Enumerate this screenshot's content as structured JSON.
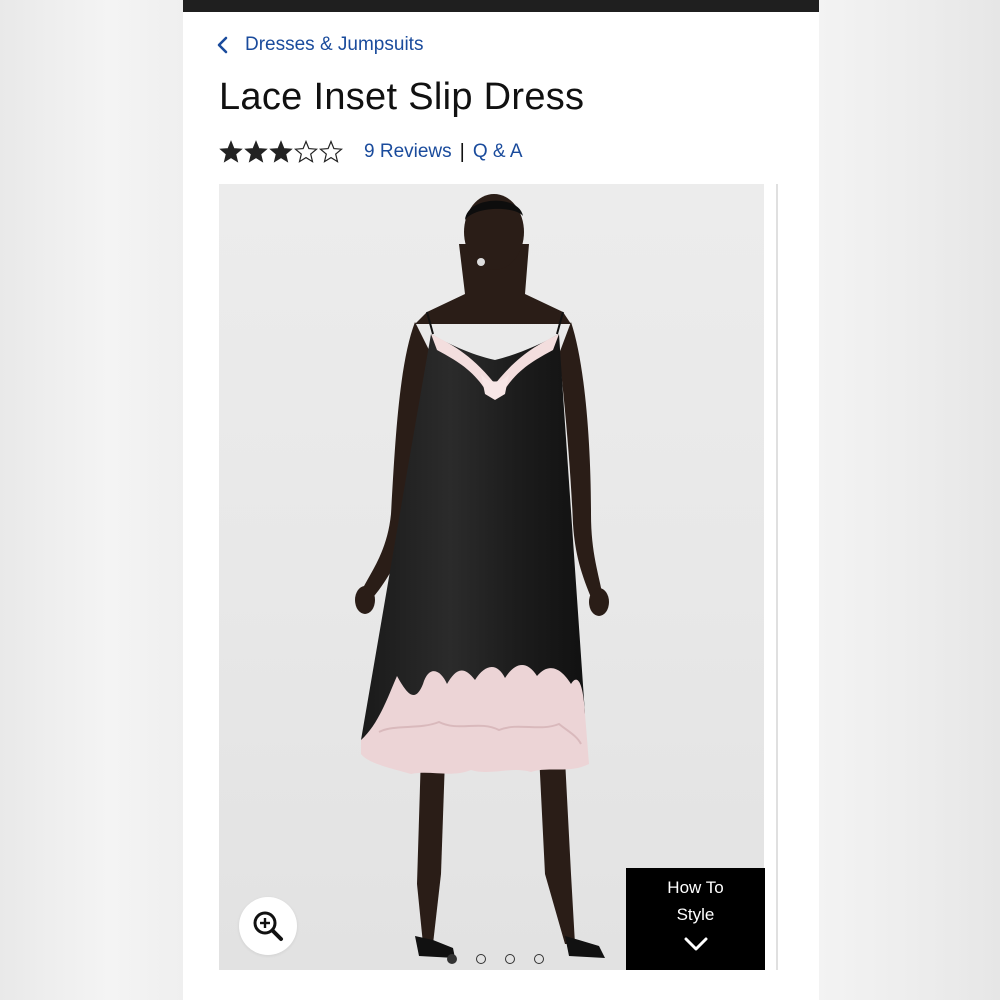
{
  "breadcrumb": {
    "label": "Dresses & Jumpsuits",
    "icon": "chevron-left-icon"
  },
  "product": {
    "title": "Lace Inset Slip Dress",
    "rating": {
      "value": 3,
      "max": 5
    },
    "reviews_label": "9 Reviews",
    "separator": "|",
    "qa_label": "Q & A"
  },
  "gallery": {
    "image_description": "model wearing black satin slip dress with pink lace trim",
    "zoom_icon": "zoom-in-icon",
    "how_to_style": {
      "line1": "How To",
      "line2": "Style",
      "icon": "chevron-down-icon"
    },
    "slides": {
      "count": 4,
      "active": 1
    }
  },
  "colors": {
    "link": "#1a4b9c",
    "top_bar": "#1f1f1f",
    "style_box": "#000000",
    "star": "#222222"
  }
}
